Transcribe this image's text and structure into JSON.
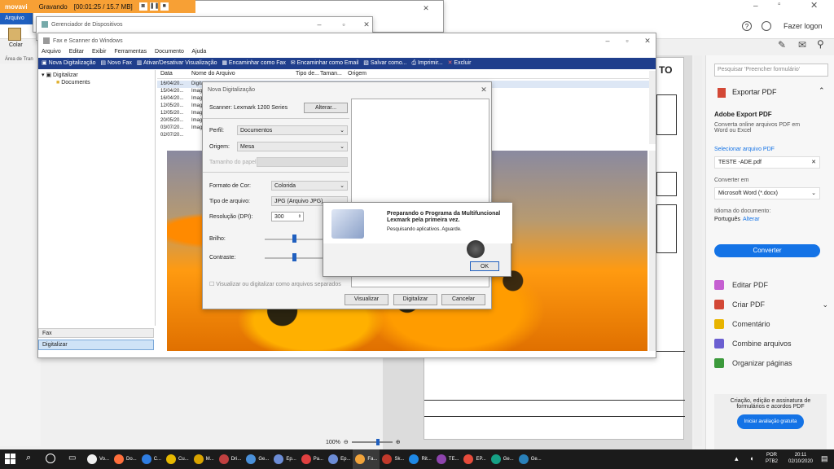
{
  "recorder": {
    "logo": "movavi",
    "status": "Gravando",
    "time": "[00:01:25 / 15.7 MB]"
  },
  "ribbon": {
    "tab_file": "Arquivo",
    "paste": "Colar",
    "clipboard": "Área de Tran"
  },
  "top_right": {
    "login": "Fazer logon"
  },
  "device_manager": {
    "title": "Gerenciador de Dispositivos"
  },
  "fax": {
    "title": "Fax e Scanner do Windows",
    "menu": [
      "Arquivo",
      "Editar",
      "Exibir",
      "Ferramentas",
      "Documento",
      "Ajuda"
    ],
    "toolbar": [
      "Nova Digitalização",
      "Novo Fax",
      "Ativar/Desativar Visualização",
      "Encaminhar como Fax",
      "Encaminhar como Email",
      "Salvar como...",
      "Imprimir...",
      "Excluir"
    ],
    "tree_root": "Digitalizar",
    "tree_child": "Documents",
    "columns": [
      "Data",
      "Nome do Arquivo",
      "Tipo de...",
      "Taman...",
      "Origem"
    ],
    "rows": [
      [
        "16/04/20...",
        "Digita"
      ],
      [
        "15/04/20...",
        "Image"
      ],
      [
        "16/04/20...",
        "Image"
      ],
      [
        "12/05/20...",
        "Image"
      ],
      [
        "12/05/20...",
        "Image"
      ],
      [
        "20/05/20...",
        "Image"
      ],
      [
        "03/07/20...",
        "Image"
      ],
      [
        "02/07/20...",
        ""
      ]
    ],
    "nav_fax": "Fax",
    "nav_scan": "Digitalizar"
  },
  "scan_dialog": {
    "title": "Nova Digitalização",
    "scanner_label": "Scanner: Lexmark 1200 Series",
    "change": "Alterar...",
    "profile_label": "Perfil:",
    "profile": "Documentos",
    "source_label": "Origem:",
    "source": "Mesa",
    "paper_label": "Tamanho do papel:",
    "color_label": "Formato de Cor:",
    "color": "Colorida",
    "type_label": "Tipo de arquivo:",
    "type": "JPG (Arquivo JPG)",
    "dpi_label": "Resolução (DPI):",
    "dpi": "300",
    "brightness_label": "Brilho:",
    "contrast_label": "Contraste:",
    "contrast_value": "0",
    "separate": "Visualizar ou digitalizar como arquivos separados",
    "preview": "Visualizar",
    "scan": "Digitalizar",
    "cancel": "Cancelar"
  },
  "lexmark": {
    "title1": "Preparando o Programa da Multifuncional",
    "title2": "Lexmark pela primeira vez.",
    "message": "Pesquisando aplicativos.  Aguarde.",
    "ok": "OK"
  },
  "doc": {
    "heading": "TO"
  },
  "zoom": {
    "value": "100%"
  },
  "acrobat": {
    "search_placeholder": "Pesquisar 'Preencher formulário'",
    "export_pdf": "Exportar PDF",
    "adobe_export": "Adobe Export PDF",
    "convert_desc": "Converta online arquivos PDF em Word ou Excel",
    "select_file": "Selecionar arquivo PDF",
    "file_name": "TESTE -ADE.pdf",
    "convert_to": "Converter em",
    "format": "Microsoft Word (*.docx)",
    "doc_lang": "Idioma do documento:",
    "lang": "Português",
    "change": "Alterar",
    "convert_btn": "Converter",
    "tools": [
      "Editar PDF",
      "Criar PDF",
      "Comentário",
      "Combine arquivos",
      "Organizar páginas"
    ],
    "promo": "Criação, edição e assinatura de formulários e acordos PDF",
    "trial": "Iniciar avaliação gratuita"
  },
  "taskbar": {
    "apps": [
      "Vo...",
      "Do...",
      "C...",
      "Cu...",
      "M...",
      "Dri...",
      "Ge...",
      "Ep...",
      "Pa...",
      "Ep...",
      "Fa...",
      "Sk...",
      "Rit...",
      "TE...",
      "EP...",
      "Ge...",
      "Ge..."
    ],
    "lang": "POR",
    "kbd": "PTB2",
    "time": "20:11",
    "date": "02/10/2020"
  },
  "colors": {
    "accent": "#1473e6",
    "recorder": "#f7a035",
    "winbar": "#1f3e8c",
    "taskbar": "#1b1b1b"
  }
}
